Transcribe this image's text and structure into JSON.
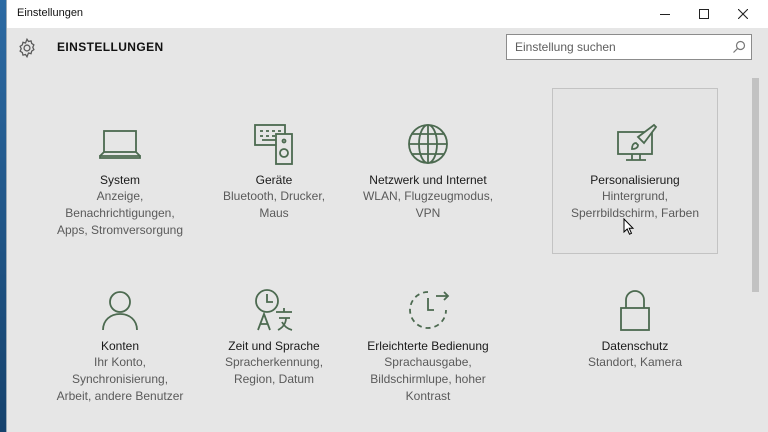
{
  "window": {
    "title": "Einstellungen",
    "minimize": "minimize",
    "maximize": "maximize",
    "close": "close"
  },
  "header": {
    "title": "EINSTELLUNGEN",
    "icon": "gear-icon",
    "search_placeholder": "Einstellung suchen",
    "search_icon": "search-icon"
  },
  "tiles": [
    {
      "title": "System",
      "description": [
        "Anzeige,",
        "Benachrichtigungen,",
        "Apps, Stromversorgung"
      ],
      "icon": "laptop-icon",
      "selected": false
    },
    {
      "title": "Geräte",
      "description": [
        "Bluetooth, Drucker,",
        "Maus"
      ],
      "icon": "devices-icon",
      "selected": false
    },
    {
      "title": "Netzwerk und Internet",
      "description": [
        "WLAN, Flugzeugmodus,",
        "VPN"
      ],
      "icon": "globe-icon",
      "selected": false
    },
    {
      "title": "Personalisierung",
      "description": [
        "Hintergrund,",
        "Sperrbildschirm, Farben"
      ],
      "icon": "personalization-icon",
      "selected": true
    },
    {
      "title": "Konten",
      "description": [
        "Ihr Konto,",
        "Synchronisierung,",
        "Arbeit, andere Benutzer"
      ],
      "icon": "person-icon",
      "selected": false
    },
    {
      "title": "Zeit und Sprache",
      "description": [
        "Spracherkennung,",
        "Region, Datum"
      ],
      "icon": "time-language-icon",
      "selected": false
    },
    {
      "title": "Erleichterte Bedienung",
      "description": [
        "Sprachausgabe,",
        "Bildschirmlupe, hoher",
        "Kontrast"
      ],
      "icon": "ease-of-access-icon",
      "selected": false
    },
    {
      "title": "Datenschutz",
      "description": [
        "Standort, Kamera"
      ],
      "icon": "lock-icon",
      "selected": false
    }
  ],
  "colors": {
    "accent_icon": "#4c6a50",
    "window_bg": "#e6e6e6",
    "titlebar_bg": "#ffffff"
  }
}
